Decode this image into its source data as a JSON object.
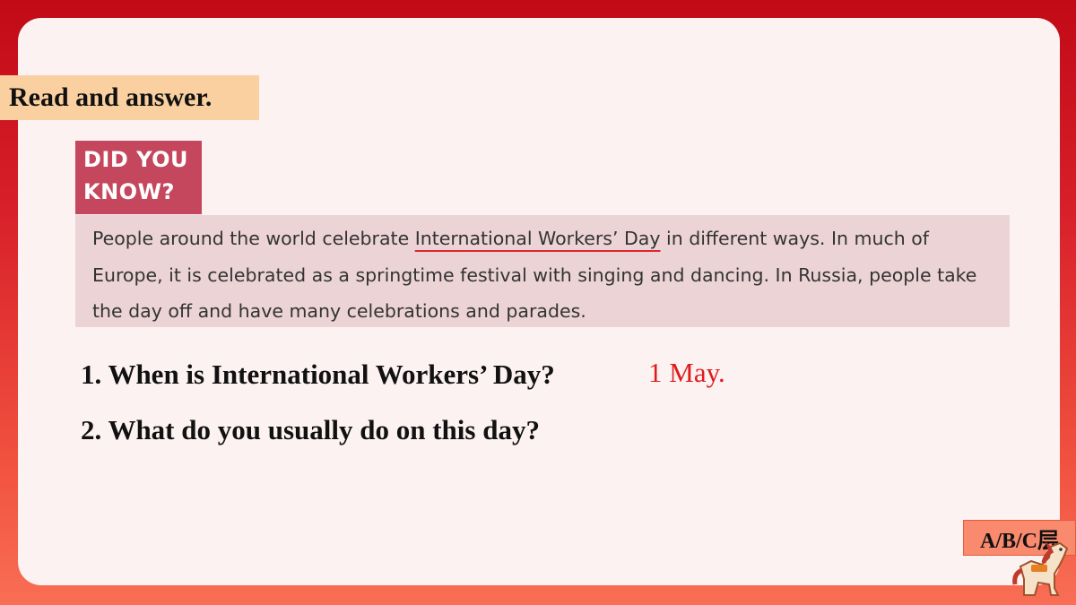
{
  "tag": {
    "label": "Read and answer."
  },
  "did_you_know": {
    "line1": "DID YOU",
    "line2": "KNOW?"
  },
  "passage": {
    "before": "People around the world celebrate ",
    "highlight": "International Workers’ Day",
    "after": " in different ways. In much of Europe, it is celebrated as a springtime festival with singing and dancing. In Russia, people take the day off and have many celebrations and parades."
  },
  "questions": [
    {
      "text": "1. When is International Workers’ Day?",
      "answer": "1 May."
    },
    {
      "text": "2. What do you usually do on this day?"
    }
  ],
  "level_badge": {
    "label": "A/B/C层"
  },
  "colors": {
    "accent": "#c10a16",
    "answer": "#e01b1b",
    "card": "#c5475d",
    "highlight_underline": "#e0262f"
  },
  "icons": {
    "mascot": "horse-mascot-icon"
  }
}
